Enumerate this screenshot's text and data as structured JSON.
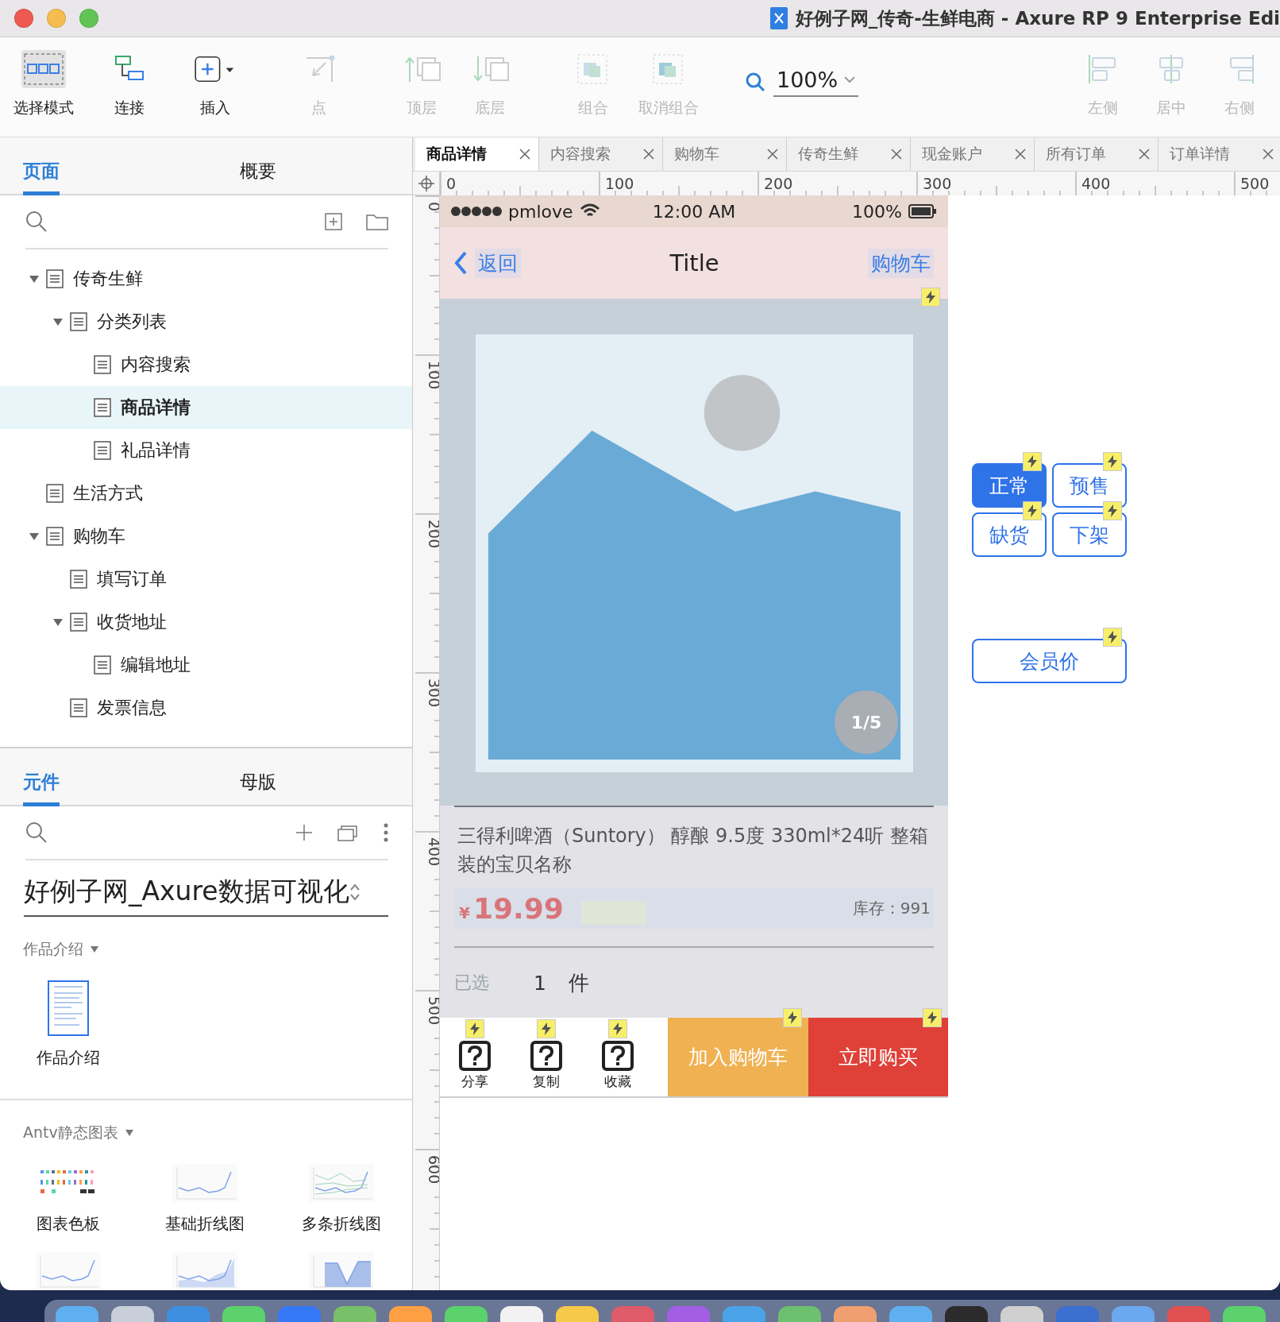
{
  "window": {
    "title": "好例子网_传奇-生鲜电商 - Axure RP 9 Enterprise Edi"
  },
  "toolbar": {
    "groups": [
      [
        {
          "kind": "select",
          "label": "选择模式",
          "selected": true,
          "disabled": false
        },
        {
          "kind": "connect",
          "label": "连接",
          "selected": false,
          "disabled": false
        },
        {
          "kind": "insert",
          "label": "插入",
          "selected": false,
          "disabled": false
        }
      ],
      [
        {
          "kind": "point",
          "label": "点",
          "selected": false,
          "disabled": true
        }
      ],
      [
        {
          "kind": "front",
          "label": "顶层",
          "selected": false,
          "disabled": true
        },
        {
          "kind": "back",
          "label": "底层",
          "selected": false,
          "disabled": true
        }
      ],
      [
        {
          "kind": "group",
          "label": "组合",
          "selected": false,
          "disabled": true
        },
        {
          "kind": "ungroup",
          "label": "取消组合",
          "selected": false,
          "disabled": true
        }
      ],
      [
        {
          "kind": "zoom",
          "value": "100%"
        }
      ],
      [
        {
          "kind": "align_left",
          "label": "左侧",
          "selected": false,
          "disabled": true
        },
        {
          "kind": "align_center",
          "label": "居中",
          "selected": false,
          "disabled": true
        },
        {
          "kind": "align_right",
          "label": "右侧",
          "selected": false,
          "disabled": true
        }
      ]
    ]
  },
  "pages_panel": {
    "tabs": [
      {
        "label": "页面",
        "selected": true
      },
      {
        "label": "概要",
        "selected": false
      }
    ],
    "tree": [
      {
        "label": "传奇生鲜",
        "selected": false,
        "expanded": true,
        "children": [
          {
            "label": "分类列表",
            "selected": false,
            "expanded": true,
            "children": [
              {
                "label": "内容搜索",
                "selected": false
              },
              {
                "label": "商品详情",
                "selected": true
              },
              {
                "label": "礼品详情",
                "selected": false
              }
            ]
          }
        ]
      },
      {
        "label": "生活方式",
        "selected": false
      },
      {
        "label": "购物车",
        "selected": false,
        "expanded": true,
        "children": [
          {
            "label": "填写订单",
            "selected": false
          },
          {
            "label": "收货地址",
            "selected": false,
            "expanded": true,
            "children": [
              {
                "label": "编辑地址",
                "selected": false
              }
            ]
          },
          {
            "label": "发票信息",
            "selected": false
          }
        ]
      }
    ]
  },
  "components_panel": {
    "tabs": [
      {
        "label": "元件",
        "selected": true
      },
      {
        "label": "母版",
        "selected": false
      }
    ],
    "library": "好例子网_Axure数据可视化",
    "sections": [
      {
        "title": "作品介绍",
        "items": [
          {
            "kind": "document",
            "label": "作品介绍"
          }
        ]
      },
      {
        "title": "Antv静态图表",
        "items": [
          {
            "kind": "palette",
            "label": "图表色板"
          },
          {
            "kind": "line",
            "label": "基础折线图"
          },
          {
            "kind": "multiline",
            "label": "多条折线图"
          },
          {
            "kind": "line"
          },
          {
            "kind": "area"
          },
          {
            "kind": "valley"
          }
        ]
      }
    ]
  },
  "canvas_tabs": [
    {
      "label": "商品详情",
      "selected": true
    },
    {
      "label": "内容搜索",
      "selected": false
    },
    {
      "label": "购物车",
      "selected": false
    },
    {
      "label": "传奇生鲜",
      "selected": false
    },
    {
      "label": "现金账户",
      "selected": false
    },
    {
      "label": "所有订单",
      "selected": false
    },
    {
      "label": "订单详情",
      "selected": false
    }
  ],
  "rulers": {
    "horizontal": [
      "0",
      "100",
      "200",
      "300",
      "400",
      "500"
    ],
    "vertical": [
      "0",
      "100",
      "200",
      "300",
      "400",
      "500",
      "600"
    ]
  },
  "phone": {
    "status_bar": {
      "carrier": "pmlove",
      "time": "12:00 AM",
      "battery": "100%"
    },
    "nav": {
      "back": "返回",
      "title": "Title",
      "action": "购物车"
    },
    "gallery": {
      "counter": "1/5",
      "interaction": true
    },
    "product": {
      "name": "三得利啤酒（Suntory） 醇酿 9.5度 330ml*24听 整箱装的宝贝名称",
      "currency": "¥",
      "price": "19.99",
      "stock": "库存：991"
    },
    "selection": {
      "label": "已选",
      "quantity": "1",
      "unit": "件"
    },
    "actions": [
      {
        "label": "分享",
        "interaction": true
      },
      {
        "label": "复制",
        "interaction": true
      },
      {
        "label": "收藏",
        "interaction": true
      }
    ],
    "buttons": [
      {
        "label": "加入购物车",
        "color": "#f0b152",
        "interaction": true
      },
      {
        "label": "立即购买",
        "color": "#df4037",
        "interaction": true
      }
    ]
  },
  "status_buttons": [
    {
      "label": "正常",
      "selected": true,
      "interaction": true
    },
    {
      "label": "预售",
      "selected": false,
      "interaction": true
    },
    {
      "label": "缺货",
      "selected": false,
      "interaction": true
    },
    {
      "label": "下架",
      "selected": false,
      "interaction": true
    }
  ],
  "member_button": {
    "label": "会员价",
    "interaction": true
  }
}
